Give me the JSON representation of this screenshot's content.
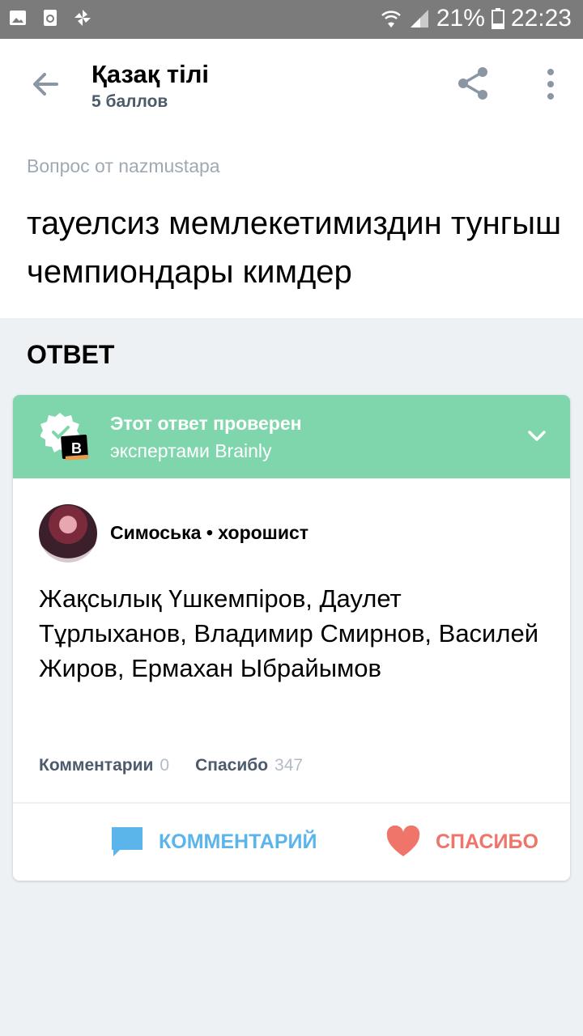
{
  "status_bar": {
    "battery": "21%",
    "time": "22:23"
  },
  "app_bar": {
    "title": "Қазақ тілі",
    "subtitle": "5 баллов"
  },
  "question": {
    "author": "Вопрос от nazmustapa",
    "text": "тауелсиз мемлекетимиздин тунгыш чемпиондары кимдер"
  },
  "answer_section_label": "ОТВЕТ",
  "answer": {
    "verified_title": "Этот ответ проверен",
    "verified_subtitle": "экспертами Brainly",
    "author_name": "Симоська",
    "author_rank": "хорошист",
    "text": "Жақсылық Үшкемпіров, Даулет Тұрлыханов, Владимир Смирнов, Василей Жиров, Ермахан Ыбрайымов",
    "comments_label": "Комментарии",
    "comments_count": "0",
    "thanks_label": "Спасибо",
    "thanks_count": "347",
    "comment_button": "КОММЕНТАРИЙ",
    "thanks_button": "СПАСИБО"
  },
  "colors": {
    "verified_bg": "#80d6ac",
    "comment_blue": "#5bb5ea",
    "thanks_red": "#ef7469"
  }
}
